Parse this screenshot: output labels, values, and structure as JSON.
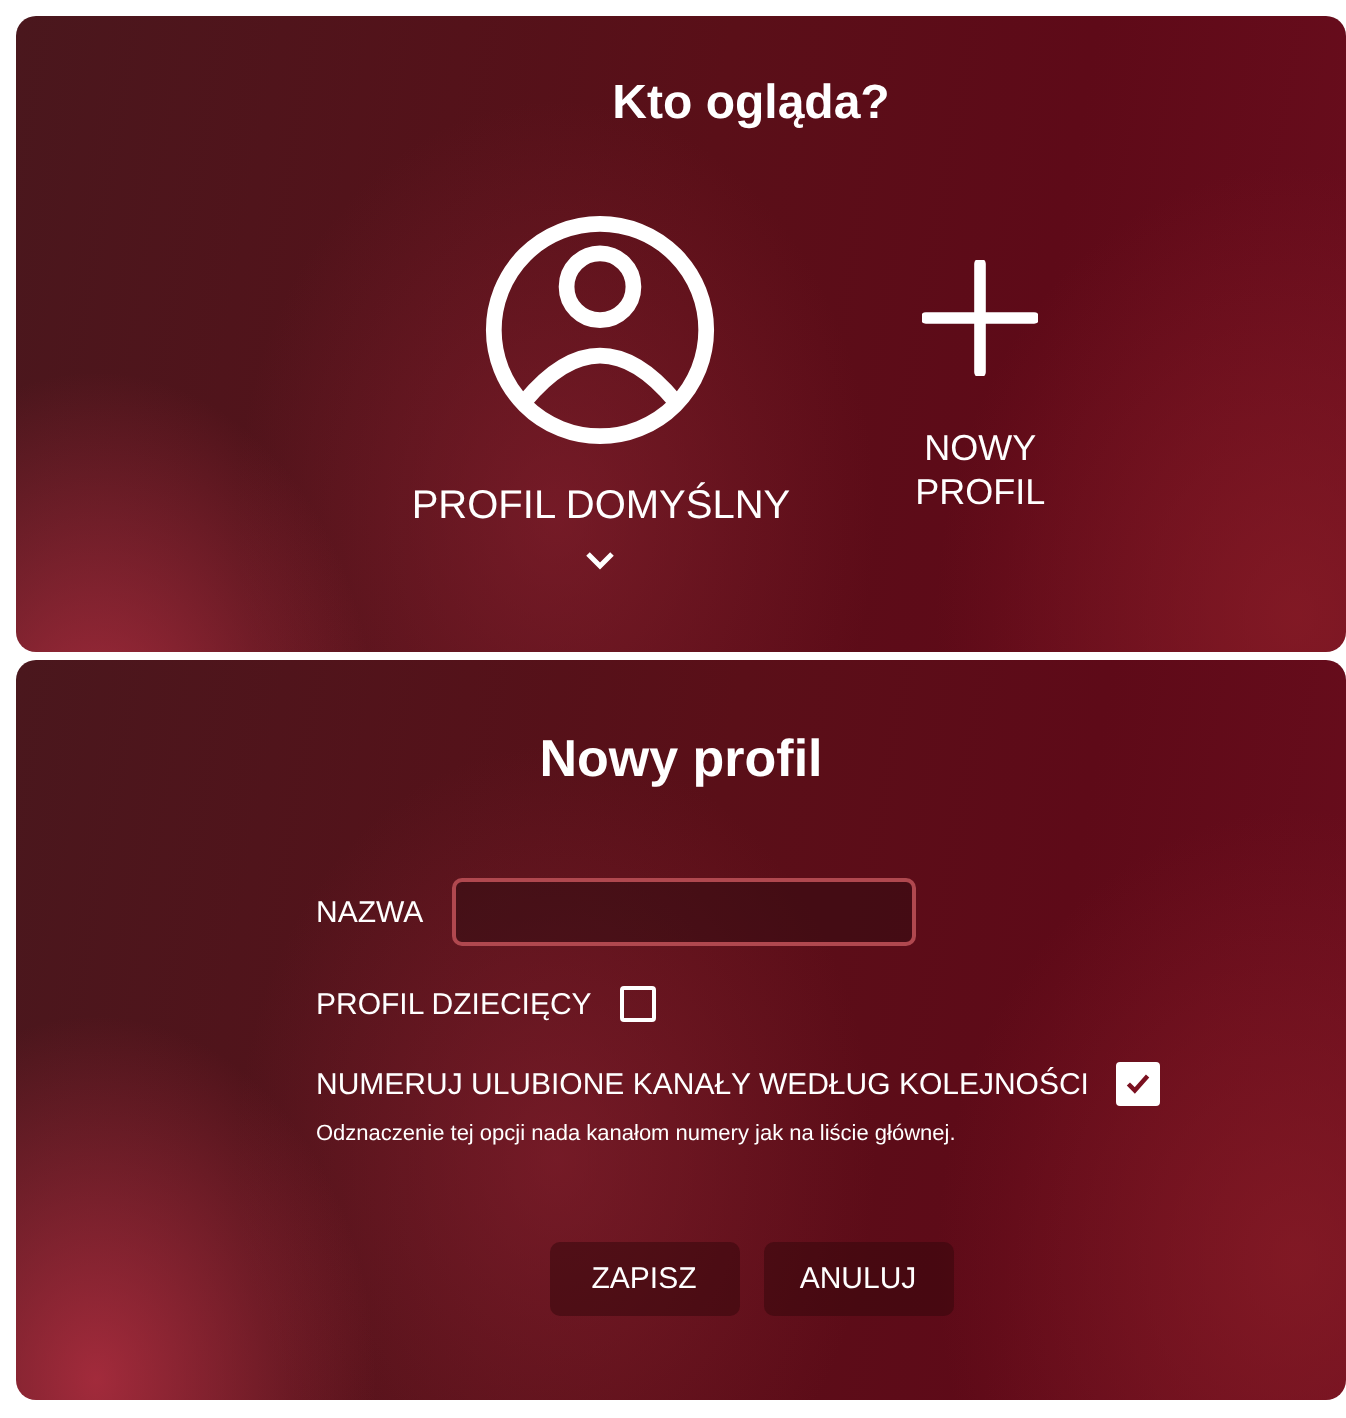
{
  "profile_picker": {
    "title": "Kto ogląda?",
    "profiles": [
      {
        "kind": "profile",
        "label": "PROFIL DOMYŚLNY",
        "expanded": false
      },
      {
        "kind": "add",
        "label": "NOWY PROFIL"
      }
    ]
  },
  "new_profile": {
    "title": "Nowy profil",
    "name_field": {
      "label": "NAZWA"
    },
    "options": [
      {
        "label": "PROFIL DZIECIĘCY",
        "checked": false
      },
      {
        "label": "NUMERUJ ULUBIONE KANAŁY WEDŁUG KOLEJNOŚCI",
        "checked": true,
        "hint": "Odznaczenie tej opcji nada kanałom numery jak na liście głównej."
      }
    ],
    "buttons": [
      "ZAPISZ",
      "ANULUJ"
    ]
  }
}
